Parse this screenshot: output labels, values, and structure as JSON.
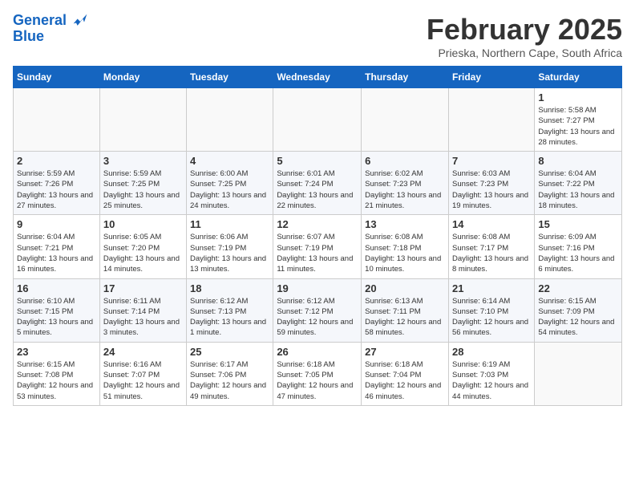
{
  "header": {
    "logo_line1": "General",
    "logo_line2": "Blue",
    "month": "February 2025",
    "location": "Prieska, Northern Cape, South Africa"
  },
  "weekdays": [
    "Sunday",
    "Monday",
    "Tuesday",
    "Wednesday",
    "Thursday",
    "Friday",
    "Saturday"
  ],
  "weeks": [
    [
      {
        "day": "",
        "info": ""
      },
      {
        "day": "",
        "info": ""
      },
      {
        "day": "",
        "info": ""
      },
      {
        "day": "",
        "info": ""
      },
      {
        "day": "",
        "info": ""
      },
      {
        "day": "",
        "info": ""
      },
      {
        "day": "1",
        "info": "Sunrise: 5:58 AM\nSunset: 7:27 PM\nDaylight: 13 hours and 28 minutes."
      }
    ],
    [
      {
        "day": "2",
        "info": "Sunrise: 5:59 AM\nSunset: 7:26 PM\nDaylight: 13 hours and 27 minutes."
      },
      {
        "day": "3",
        "info": "Sunrise: 5:59 AM\nSunset: 7:25 PM\nDaylight: 13 hours and 25 minutes."
      },
      {
        "day": "4",
        "info": "Sunrise: 6:00 AM\nSunset: 7:25 PM\nDaylight: 13 hours and 24 minutes."
      },
      {
        "day": "5",
        "info": "Sunrise: 6:01 AM\nSunset: 7:24 PM\nDaylight: 13 hours and 22 minutes."
      },
      {
        "day": "6",
        "info": "Sunrise: 6:02 AM\nSunset: 7:23 PM\nDaylight: 13 hours and 21 minutes."
      },
      {
        "day": "7",
        "info": "Sunrise: 6:03 AM\nSunset: 7:23 PM\nDaylight: 13 hours and 19 minutes."
      },
      {
        "day": "8",
        "info": "Sunrise: 6:04 AM\nSunset: 7:22 PM\nDaylight: 13 hours and 18 minutes."
      }
    ],
    [
      {
        "day": "9",
        "info": "Sunrise: 6:04 AM\nSunset: 7:21 PM\nDaylight: 13 hours and 16 minutes."
      },
      {
        "day": "10",
        "info": "Sunrise: 6:05 AM\nSunset: 7:20 PM\nDaylight: 13 hours and 14 minutes."
      },
      {
        "day": "11",
        "info": "Sunrise: 6:06 AM\nSunset: 7:19 PM\nDaylight: 13 hours and 13 minutes."
      },
      {
        "day": "12",
        "info": "Sunrise: 6:07 AM\nSunset: 7:19 PM\nDaylight: 13 hours and 11 minutes."
      },
      {
        "day": "13",
        "info": "Sunrise: 6:08 AM\nSunset: 7:18 PM\nDaylight: 13 hours and 10 minutes."
      },
      {
        "day": "14",
        "info": "Sunrise: 6:08 AM\nSunset: 7:17 PM\nDaylight: 13 hours and 8 minutes."
      },
      {
        "day": "15",
        "info": "Sunrise: 6:09 AM\nSunset: 7:16 PM\nDaylight: 13 hours and 6 minutes."
      }
    ],
    [
      {
        "day": "16",
        "info": "Sunrise: 6:10 AM\nSunset: 7:15 PM\nDaylight: 13 hours and 5 minutes."
      },
      {
        "day": "17",
        "info": "Sunrise: 6:11 AM\nSunset: 7:14 PM\nDaylight: 13 hours and 3 minutes."
      },
      {
        "day": "18",
        "info": "Sunrise: 6:12 AM\nSunset: 7:13 PM\nDaylight: 13 hours and 1 minute."
      },
      {
        "day": "19",
        "info": "Sunrise: 6:12 AM\nSunset: 7:12 PM\nDaylight: 12 hours and 59 minutes."
      },
      {
        "day": "20",
        "info": "Sunrise: 6:13 AM\nSunset: 7:11 PM\nDaylight: 12 hours and 58 minutes."
      },
      {
        "day": "21",
        "info": "Sunrise: 6:14 AM\nSunset: 7:10 PM\nDaylight: 12 hours and 56 minutes."
      },
      {
        "day": "22",
        "info": "Sunrise: 6:15 AM\nSunset: 7:09 PM\nDaylight: 12 hours and 54 minutes."
      }
    ],
    [
      {
        "day": "23",
        "info": "Sunrise: 6:15 AM\nSunset: 7:08 PM\nDaylight: 12 hours and 53 minutes."
      },
      {
        "day": "24",
        "info": "Sunrise: 6:16 AM\nSunset: 7:07 PM\nDaylight: 12 hours and 51 minutes."
      },
      {
        "day": "25",
        "info": "Sunrise: 6:17 AM\nSunset: 7:06 PM\nDaylight: 12 hours and 49 minutes."
      },
      {
        "day": "26",
        "info": "Sunrise: 6:18 AM\nSunset: 7:05 PM\nDaylight: 12 hours and 47 minutes."
      },
      {
        "day": "27",
        "info": "Sunrise: 6:18 AM\nSunset: 7:04 PM\nDaylight: 12 hours and 46 minutes."
      },
      {
        "day": "28",
        "info": "Sunrise: 6:19 AM\nSunset: 7:03 PM\nDaylight: 12 hours and 44 minutes."
      },
      {
        "day": "",
        "info": ""
      }
    ]
  ]
}
